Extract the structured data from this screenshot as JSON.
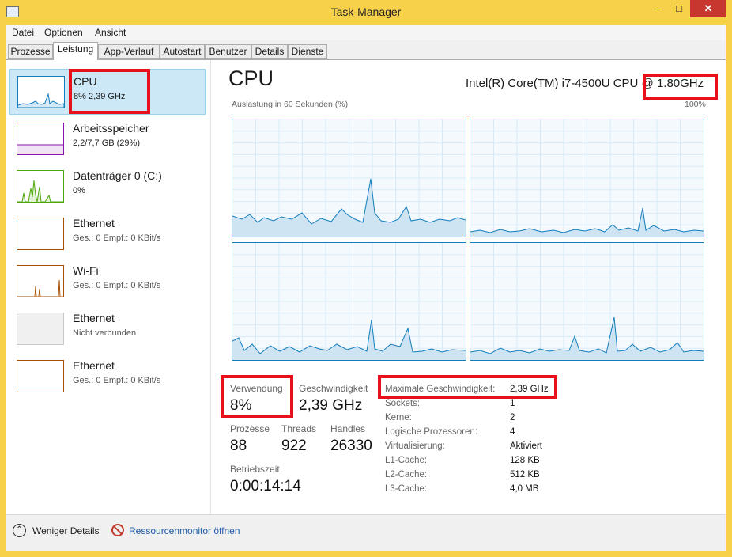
{
  "window": {
    "title": "Task-Manager",
    "minimize": "–",
    "maximize": "□",
    "close": "✕",
    "icon": "task-manager-icon"
  },
  "menu": [
    "Datei",
    "Optionen",
    "Ansicht"
  ],
  "tabs": [
    "Prozesse",
    "Leistung",
    "App-Verlauf",
    "Autostart",
    "Benutzer",
    "Details",
    "Dienste"
  ],
  "active_tab": "Leistung",
  "sidebar": [
    {
      "name": "CPU",
      "detail": "8% 2,39 GHz",
      "color": "#117dbb"
    },
    {
      "name": "Arbeitsspeicher",
      "detail": "2,2/7,7 GB (29%)",
      "color": "#8b12ae"
    },
    {
      "name": "Datenträger 0 (C:)",
      "detail": "0%",
      "color": "#4da60c"
    },
    {
      "name": "Ethernet",
      "detail": "Ges.: 0 Empf.: 0 KBit/s",
      "color": "#a74f01"
    },
    {
      "name": "Wi-Fi",
      "detail": "Ges.: 0 Empf.: 0 KBit/s",
      "color": "#a74f01"
    },
    {
      "name": "Ethernet",
      "detail": "Nicht verbunden",
      "color": "#c8c8c8"
    },
    {
      "name": "Ethernet",
      "detail": "Ges.: 0 Empf.: 0 KBit/s",
      "color": "#a74f01"
    }
  ],
  "cpu": {
    "title": "CPU",
    "model": "Intel(R) Core(TM) i7-4500U CPU @ 1.80GHz",
    "graph_caption": "Auslastung in 60 Sekunden (%)",
    "graph_max": "100%",
    "accent": "#117dbb"
  },
  "stats": {
    "usage_label": "Verwendung",
    "usage": "8%",
    "speed_label": "Geschwindigkeit",
    "speed": "2,39 GHz",
    "processes_label": "Prozesse",
    "processes": "88",
    "threads_label": "Threads",
    "threads": "922",
    "handles_label": "Handles",
    "handles": "26330",
    "uptime_label": "Betriebszeit",
    "uptime": "0:00:14:14"
  },
  "specs": [
    {
      "label": "Maximale Geschwindigkeit:",
      "value": "2,39 GHz"
    },
    {
      "label": "Sockets:",
      "value": "1"
    },
    {
      "label": "Kerne:",
      "value": "2"
    },
    {
      "label": "Logische Prozessoren:",
      "value": "4"
    },
    {
      "label": "Virtualisierung:",
      "value": "Aktiviert"
    },
    {
      "label": "L1-Cache:",
      "value": "128 KB"
    },
    {
      "label": "L2-Cache:",
      "value": "512 KB"
    },
    {
      "label": "L3-Cache:",
      "value": "4,0 MB"
    }
  ],
  "bottom": {
    "fewer_details": "Weniger Details",
    "resource_monitor": "Ressourcenmonitor öffnen"
  },
  "highlight_color": "#e8101b"
}
